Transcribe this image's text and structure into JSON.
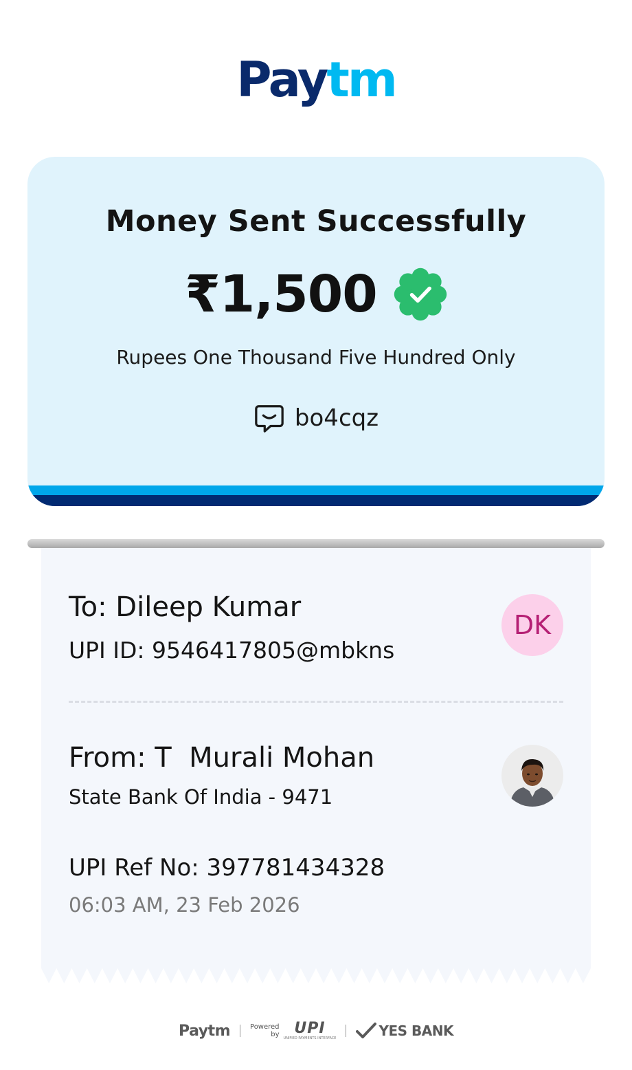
{
  "brand": {
    "logo_part1": "Pay",
    "logo_part2": "tm",
    "dark_blue": "#0a2a6b",
    "light_blue": "#00b9f1"
  },
  "status": {
    "title": "Money Sent Successfully",
    "amount": "₹1,500",
    "amount_in_words": "Rupees One Thousand Five Hundred Only",
    "note": "bo4cqz",
    "verified_icon": "verified-badge-icon",
    "note_icon": "message-icon",
    "success_color": "#2bbd6e"
  },
  "recipient": {
    "label_name": "To: Dileep Kumar",
    "upi_id": "UPI ID: 9546417805@mbkns",
    "initials": "DK",
    "avatar_bg": "#fcd0ea",
    "avatar_fg": "#b51f74"
  },
  "sender": {
    "label_name": "From: T  Murali Mohan",
    "bank": "State Bank Of India - 9471"
  },
  "transaction": {
    "ref_no": "UPI Ref No: 397781434328",
    "timestamp": "06:03 AM, 23 Feb 2026"
  },
  "footer": {
    "paytm": "Paytm",
    "powered_by_line1": "Powered",
    "powered_by_line2": "by",
    "upi": "UPI",
    "upi_tagline": "UNIFIED PAYMENTS INTERFACE",
    "bank": "YES BANK"
  }
}
